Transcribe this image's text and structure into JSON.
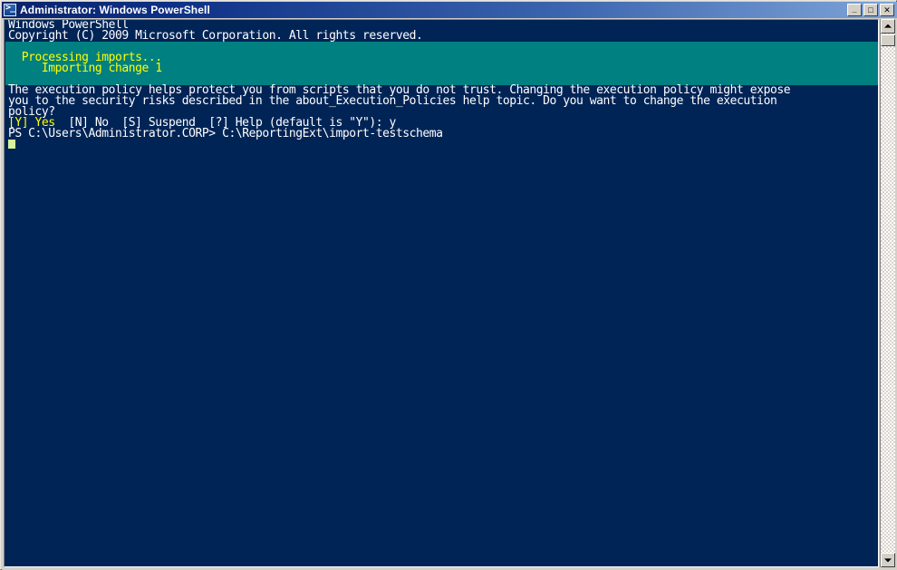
{
  "window": {
    "title": "Administrator: Windows PowerShell",
    "icon": "powershell-icon",
    "buttons": {
      "minimize": "_",
      "maximize": "□",
      "close": "✕"
    }
  },
  "colors": {
    "console_background": "#012456",
    "console_foreground": "#ffffff",
    "progress_background": "#008080",
    "progress_foreground": "#ffff00",
    "prompt_highlight": "#ffff00",
    "cursor": "#d7f39a",
    "titlebar_start": "#0a246a",
    "titlebar_end": "#7fa4d8"
  },
  "console": {
    "banner": [
      "Windows PowerShell",
      "Copyright (C) 2009 Microsoft Corporation. All rights reserved."
    ],
    "progress_block": {
      "blank_top": "",
      "activity": "  Processing imports...",
      "status": "     Importing change 1",
      "blank_bottom": ""
    },
    "warning": [
      "The execution policy helps protect you from scripts that you do not trust. Changing the execution policy might expose",
      "you to the security risks described in the about_Execution_Policies help topic. Do you want to change the execution",
      "policy?"
    ],
    "choice_prompt": {
      "highlight": "[Y] Yes",
      "rest": "  [N] No  [S] Suspend  [?] Help (default is \"Y\"): ",
      "answer": "y"
    },
    "command_line": {
      "prompt": "PS C:\\Users\\Administrator.CORP> ",
      "command": "C:\\ReportingExt\\import-testschema"
    }
  },
  "scrollbar": {
    "up_arrow": "scroll-up-arrow-icon",
    "down_arrow": "scroll-down-arrow-icon",
    "thumb": "scroll-thumb"
  }
}
